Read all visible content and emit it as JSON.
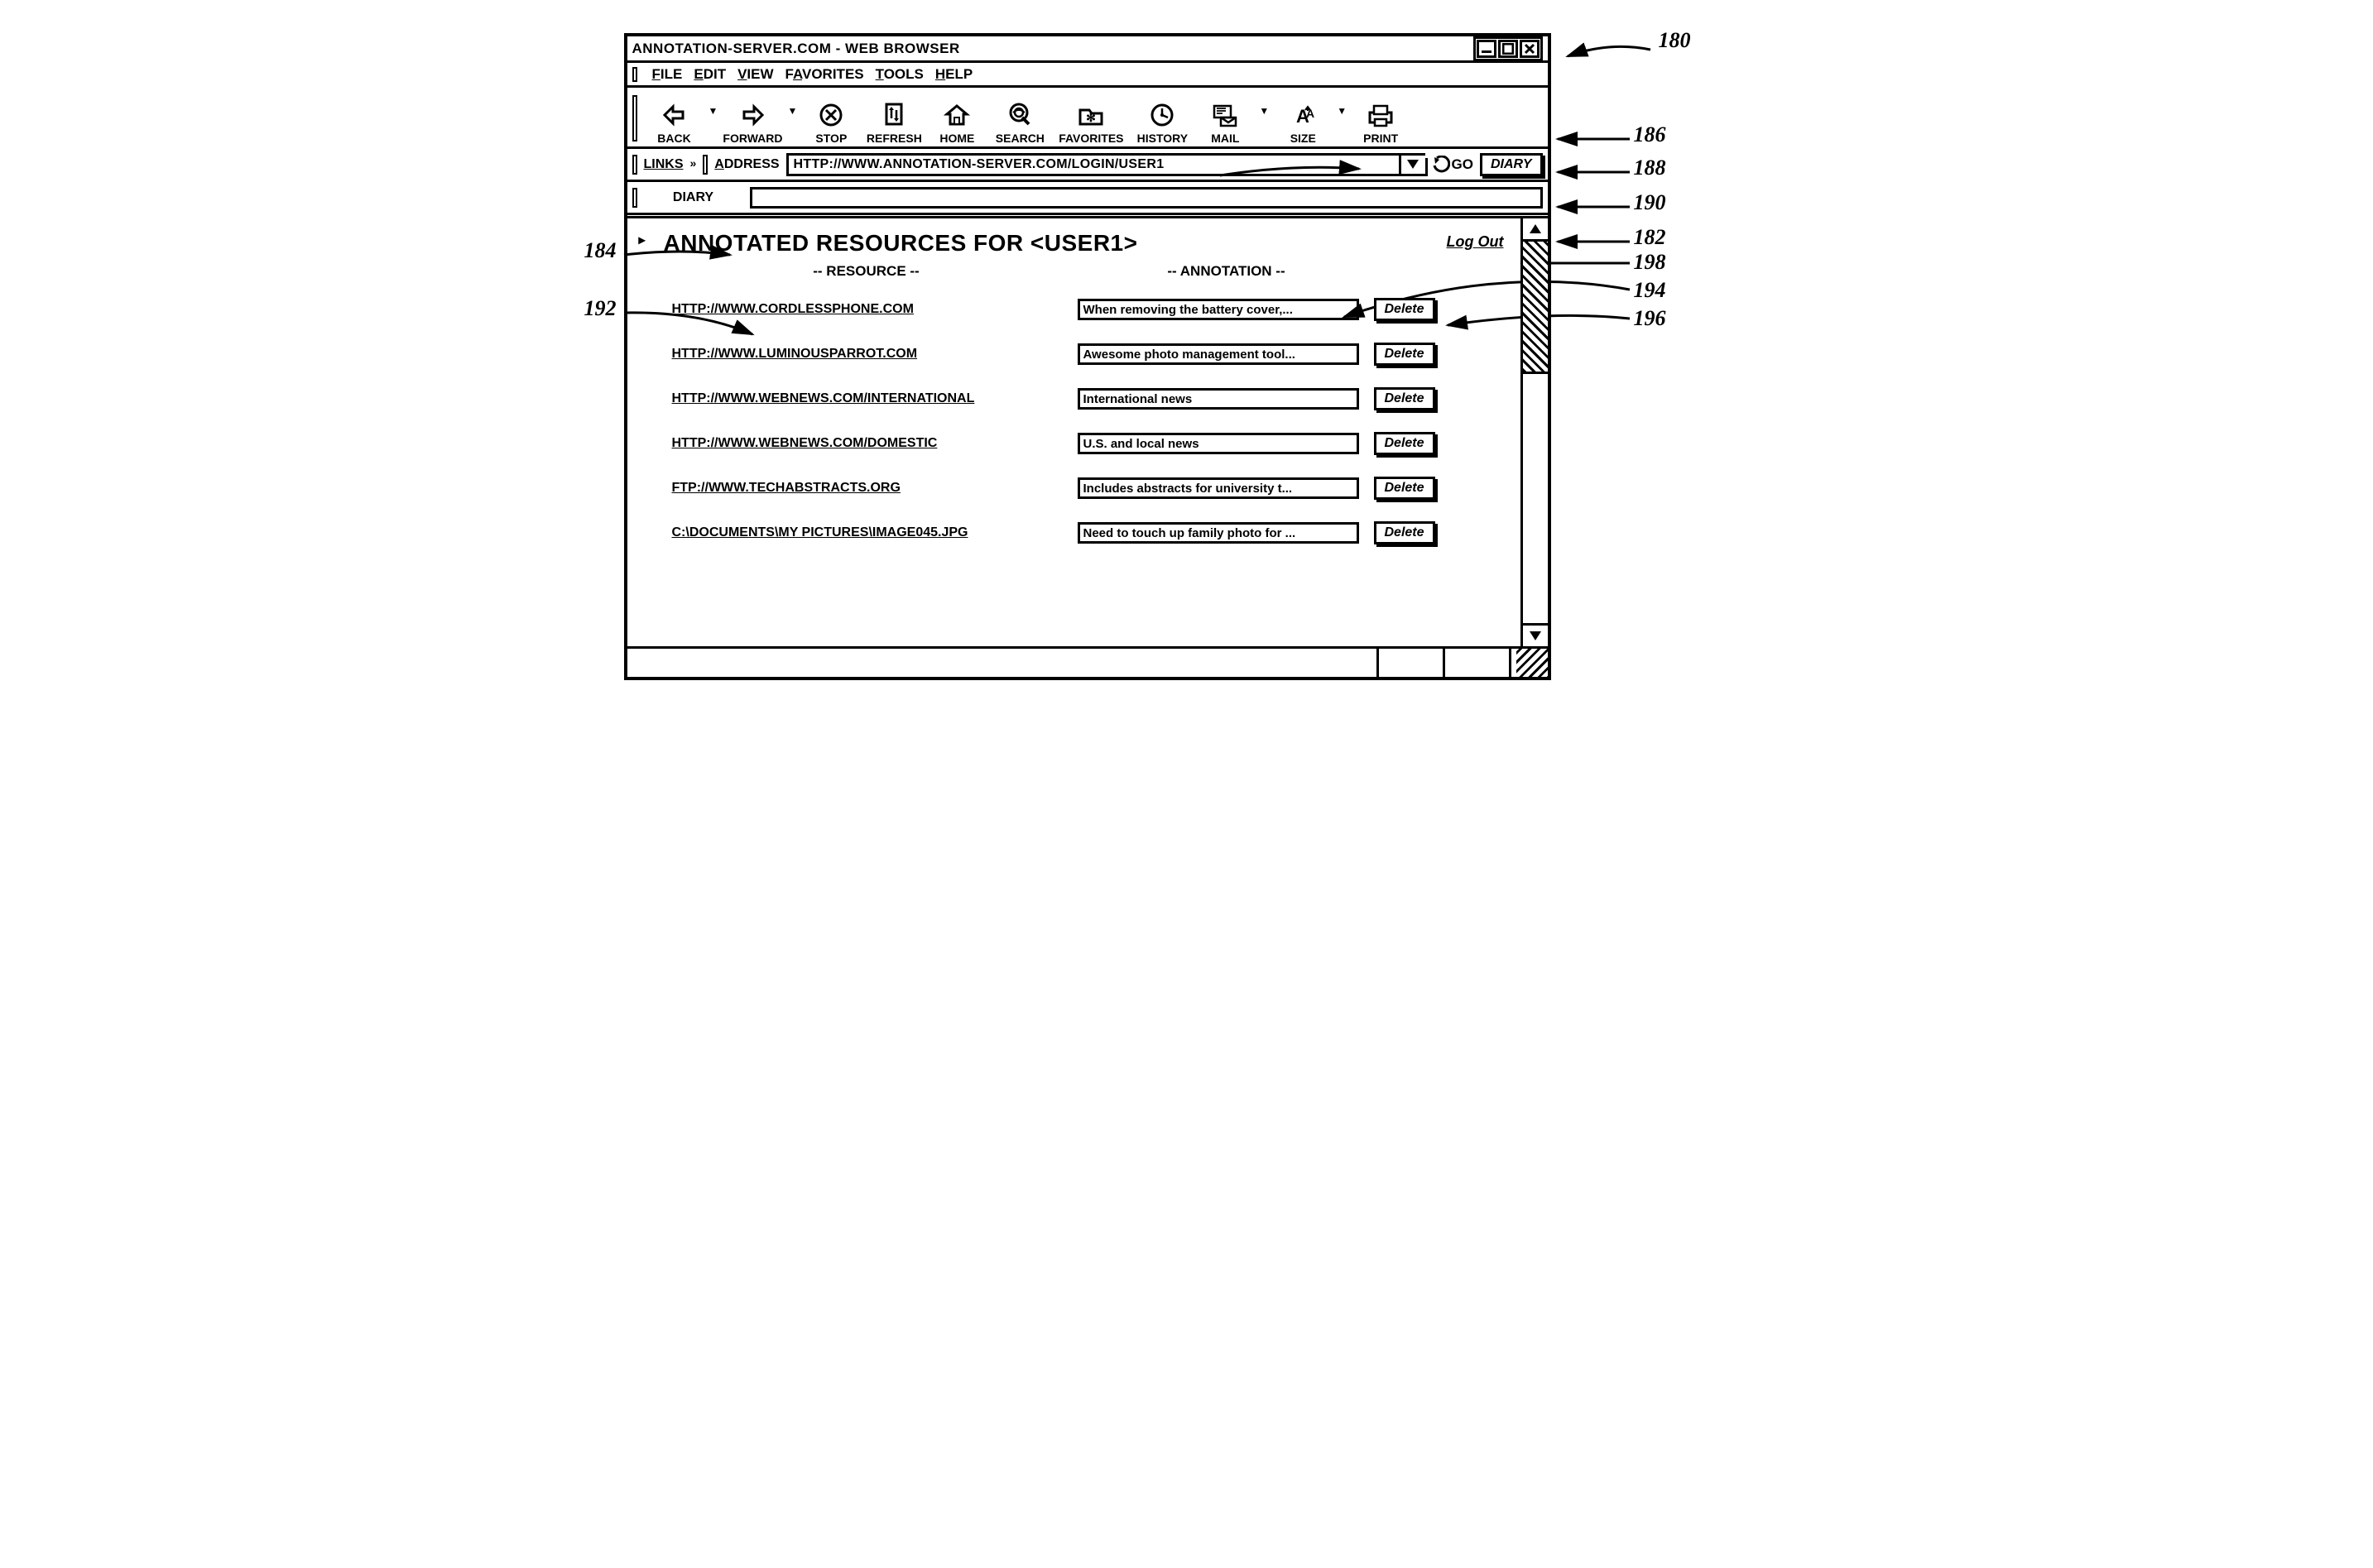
{
  "window": {
    "title": "ANNOTATION-SERVER.COM - WEB BROWSER"
  },
  "menus": {
    "file": "FILE",
    "edit": "EDIT",
    "view": "VIEW",
    "favorites": "FAVORITES",
    "tools": "TOOLS",
    "help": "HELP"
  },
  "toolbar": {
    "back": "BACK",
    "forward": "FORWARD",
    "stop": "STOP",
    "refresh": "REFRESH",
    "home": "HOME",
    "search": "SEARCH",
    "favorites": "FAVORITES",
    "history": "HISTORY",
    "mail": "MAIL",
    "size": "SIZE",
    "print": "PRINT"
  },
  "address": {
    "links_label": "LINKS",
    "label": "ADDRESS",
    "url": "HTTP://WWW.ANNOTATION-SERVER.COM/LOGIN/USER1",
    "go": "GO",
    "diary_button": "DIARY"
  },
  "diary": {
    "label": "DIARY",
    "value": ""
  },
  "page": {
    "title": "ANNOTATED RESOURCES FOR <USER1>",
    "logout": "Log Out",
    "col_resource": "-- RESOURCE --",
    "col_annotation": "-- ANNOTATION --",
    "delete_label": "Delete",
    "rows": [
      {
        "resource": "HTTP://WWW.CORDLESSPHONE.COM",
        "annotation": "When removing the battery cover,..."
      },
      {
        "resource": "HTTP://WWW.LUMINOUSPARROT.COM",
        "annotation": "Awesome photo management tool..."
      },
      {
        "resource": "HTTP://WWW.WEBNEWS.COM/INTERNATIONAL",
        "annotation": "International news"
      },
      {
        "resource": "HTTP://WWW.WEBNEWS.COM/DOMESTIC",
        "annotation": "U.S. and local news"
      },
      {
        "resource": "FTP://WWW.TECHABSTRACTS.ORG",
        "annotation": "Includes abstracts for university t..."
      },
      {
        "resource": "C:\\DOCUMENTS\\MY PICTURES\\IMAGE045.JPG",
        "annotation": "Need to touch up family photo for ..."
      }
    ]
  },
  "callouts": {
    "c180": "180",
    "c182": "182",
    "c184": "184",
    "c186": "186",
    "c188": "188",
    "c190": "190",
    "c192": "192",
    "c194": "194",
    "c196": "196",
    "c198": "198"
  }
}
